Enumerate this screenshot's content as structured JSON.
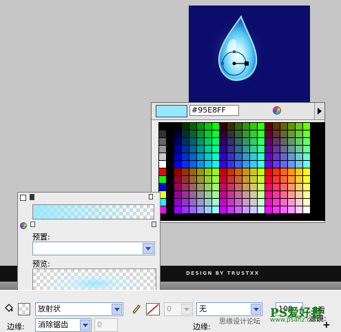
{
  "canvas": {
    "watermark": "DESIGN BY TRUSTXX"
  },
  "palette": {
    "selected_color": "#95E8FF",
    "hex_value": "#95E8FF",
    "icons": [
      "color-wheel-icon",
      "palette-menu-arrow-icon"
    ]
  },
  "fill_panel": {
    "preset_label": "预置:",
    "preset_value": "",
    "preview_label": "预览:"
  },
  "property_bar": {
    "fill_type": "放射状",
    "stroke_size": "0",
    "stroke_style": "无",
    "zoom_value": "100",
    "snap_label": "E看",
    "edge_label": "边缘:",
    "edge_mode": "消除锯齿",
    "edge_value": "0",
    "edge2_label": "边缘:",
    "filter_label": "滤镜:",
    "add_symbol": "+"
  },
  "overlay": {
    "site_text_1": "思缘设计论坛",
    "site_text_2": "www.psahz.com",
    "logo_text": "PS爱好者"
  }
}
